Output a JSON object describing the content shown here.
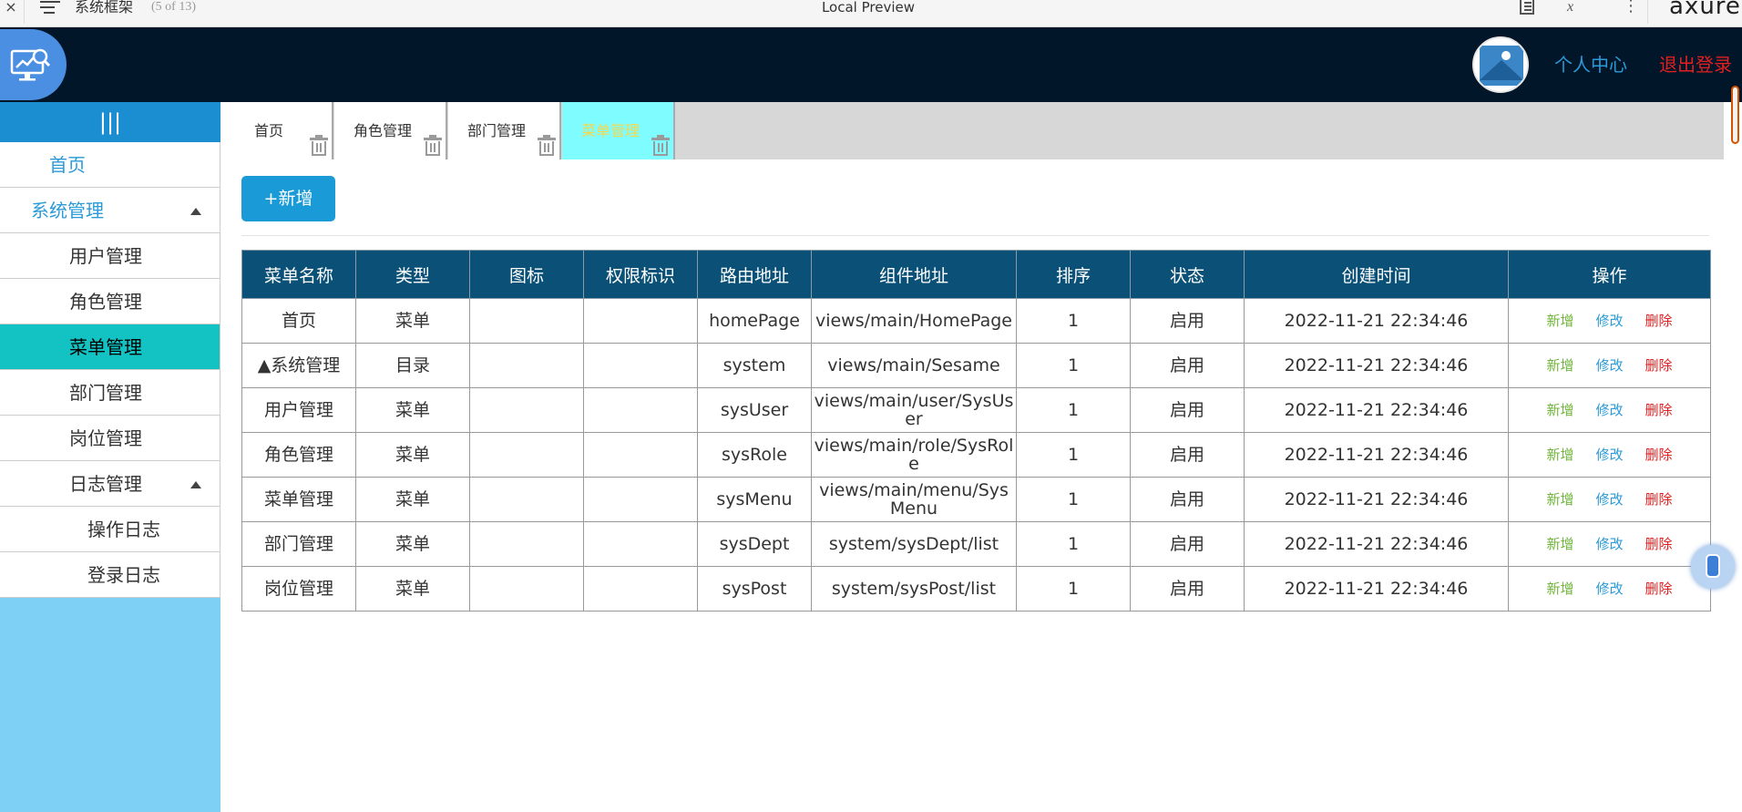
{
  "axure": {
    "close": "×",
    "page_name": "系统框架",
    "page_count": "(5 of 13)",
    "title": "Local Preview",
    "logo": "axure",
    "more": "⋮",
    "formula": "x"
  },
  "header": {
    "user_center": "个人中心",
    "logout": "退出登录"
  },
  "sidebar": {
    "toggle": "|||",
    "items": [
      {
        "label": "首页"
      },
      {
        "label": "系统管理"
      },
      {
        "label": "用户管理"
      },
      {
        "label": "角色管理"
      },
      {
        "label": "菜单管理"
      },
      {
        "label": "部门管理"
      },
      {
        "label": "岗位管理"
      },
      {
        "label": "日志管理"
      },
      {
        "label": "操作日志"
      },
      {
        "label": "登录日志"
      }
    ]
  },
  "tabs": [
    {
      "label": "首页"
    },
    {
      "label": "角色管理"
    },
    {
      "label": "部门管理"
    },
    {
      "label": "菜单管理"
    }
  ],
  "toolbar": {
    "add_label": "+新增"
  },
  "table": {
    "columns": [
      "菜单名称",
      "类型",
      "图标",
      "权限标识",
      "路由地址",
      "组件地址",
      "排序",
      "状态",
      "创建时间",
      "操作"
    ],
    "rows": [
      {
        "name": "首页",
        "type": "菜单",
        "icon": "",
        "perm": "",
        "route": "homePage",
        "component": "views/main/HomePage",
        "order": "1",
        "status": "启用",
        "created": "2022-11-21 22:34:46"
      },
      {
        "name": "▲系统管理",
        "type": "目录",
        "icon": "",
        "perm": "",
        "route": "system",
        "component": "views/main/Sesame",
        "order": "1",
        "status": "启用",
        "created": "2022-11-21 22:34:46"
      },
      {
        "name": "用户管理",
        "type": "菜单",
        "icon": "",
        "perm": "",
        "route": "sysUser",
        "component": "views/main/user/SysUser",
        "order": "1",
        "status": "启用",
        "created": "2022-11-21 22:34:46"
      },
      {
        "name": "角色管理",
        "type": "菜单",
        "icon": "",
        "perm": "",
        "route": "sysRole",
        "component": "views/main/role/SysRole",
        "order": "1",
        "status": "启用",
        "created": "2022-11-21 22:34:46"
      },
      {
        "name": "菜单管理",
        "type": "菜单",
        "icon": "",
        "perm": "",
        "route": "sysMenu",
        "component": "views/main/menu/SysMenu",
        "order": "1",
        "status": "启用",
        "created": "2022-11-21 22:34:46"
      },
      {
        "name": "部门管理",
        "type": "菜单",
        "icon": "",
        "perm": "",
        "route": "sysDept",
        "component": "system/sysDept/list",
        "order": "1",
        "status": "启用",
        "created": "2022-11-21 22:34:46"
      },
      {
        "name": "岗位管理",
        "type": "菜单",
        "icon": "",
        "perm": "",
        "route": "sysPost",
        "component": "system/sysPost/list",
        "order": "1",
        "status": "启用",
        "created": "2022-11-21 22:34:46"
      }
    ],
    "ops": {
      "add": "新增",
      "edit": "修改",
      "delete": "删除"
    }
  }
}
